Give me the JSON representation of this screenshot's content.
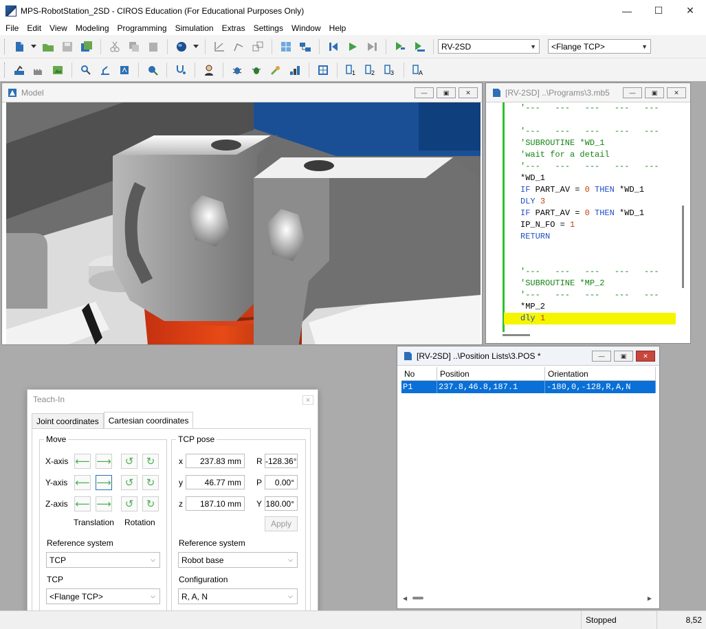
{
  "window": {
    "title": "MPS-RobotStation_2SD - CIROS Education (For Educational Purposes Only)",
    "minimize_icon": "minimize-icon",
    "maximize_icon": "maximize-icon",
    "close_icon": "close-icon"
  },
  "menu": [
    "File",
    "Edit",
    "View",
    "Modeling",
    "Programming",
    "Simulation",
    "Extras",
    "Settings",
    "Window",
    "Help"
  ],
  "toolbar": {
    "robot_combo": "RV-2SD",
    "tcp_combo": "<Flange TCP>"
  },
  "model_window": {
    "title": "Model"
  },
  "program_window": {
    "title": "[RV-2SD] ..\\Programs\\3.mb5",
    "lines": [
      {
        "text": "'---   ---   ---   ---   ---",
        "cls": "cm"
      },
      {
        "text": "",
        "cls": "pl"
      },
      {
        "text": "'---   ---   ---   ---   ---",
        "cls": "cm"
      },
      {
        "text": "'SUBROUTINE *WD_1",
        "cls": "cm"
      },
      {
        "text": "'wait for a detail",
        "cls": "cm"
      },
      {
        "text": "'---   ---   ---   ---   ---",
        "cls": "cm"
      },
      {
        "text": "*WD_1",
        "cls": "pl"
      },
      {
        "parts": [
          [
            "IF",
            "kw"
          ],
          [
            " PART_AV = ",
            "pl"
          ],
          [
            "0",
            "num"
          ],
          [
            " ",
            "pl"
          ],
          [
            "THEN",
            "kw"
          ],
          [
            " *WD_1",
            "pl"
          ]
        ]
      },
      {
        "parts": [
          [
            "DLY",
            "kw"
          ],
          [
            " ",
            "pl"
          ],
          [
            "3",
            "num"
          ]
        ]
      },
      {
        "parts": [
          [
            "IF",
            "kw"
          ],
          [
            " PART_AV = ",
            "pl"
          ],
          [
            "0",
            "num"
          ],
          [
            " ",
            "pl"
          ],
          [
            "THEN",
            "kw"
          ],
          [
            " *WD_1",
            "pl"
          ]
        ]
      },
      {
        "parts": [
          [
            "IP_N_FO = ",
            "pl"
          ],
          [
            "1",
            "num"
          ]
        ]
      },
      {
        "text": "RETURN",
        "cls": "kw"
      },
      {
        "text": "",
        "cls": "pl"
      },
      {
        "text": "",
        "cls": "pl"
      },
      {
        "text": "'---   ---   ---   ---   ---",
        "cls": "cm"
      },
      {
        "text": "'SUBROUTINE *MP_2",
        "cls": "cm"
      },
      {
        "text": "'---   ---   ---   ---   ---",
        "cls": "cm"
      },
      {
        "text": "*MP_2",
        "cls": "pl"
      },
      {
        "parts": [
          [
            "dly",
            "kw"
          ],
          [
            " ",
            "pl"
          ],
          [
            "1",
            "num"
          ]
        ],
        "highlight": true
      }
    ]
  },
  "position_window": {
    "title": "[RV-2SD] ..\\Position Lists\\3.POS *",
    "columns": [
      "No",
      "Position",
      "Orientation"
    ],
    "rows": [
      {
        "no": "P1",
        "position": "237.8,46.8,187.1",
        "orientation": "-180,0,-128,R,A,N"
      }
    ]
  },
  "teach_in": {
    "title": "Teach-In",
    "tabs": [
      "Joint coordinates",
      "Cartesian coordinates"
    ],
    "move": {
      "title": "Move",
      "axes": [
        "X-axis",
        "Y-axis",
        "Z-axis"
      ],
      "translation_label": "Translation",
      "rotation_label": "Rotation"
    },
    "tcp_pose": {
      "title": "TCP pose",
      "x_label": "x",
      "x_value": "237.83 mm",
      "y_label": "y",
      "y_value": "46.77 mm",
      "z_label": "z",
      "z_value": "187.10 mm",
      "r_label": "R",
      "r_value": "-128.36°",
      "p_label": "P",
      "p_value": "0.00°",
      "yaw_label": "Y",
      "yaw_value": "180.00°",
      "apply": "Apply"
    },
    "left_ref_label": "Reference system",
    "left_ref_value": "TCP",
    "tcp_label": "TCP",
    "tcp_value": "<Flange TCP>",
    "right_ref_label": "Reference system",
    "right_ref_value": "Robot base",
    "config_label": "Configuration",
    "config_value": "R, A, N"
  },
  "status": {
    "state": "Stopped",
    "value": "8,52"
  }
}
